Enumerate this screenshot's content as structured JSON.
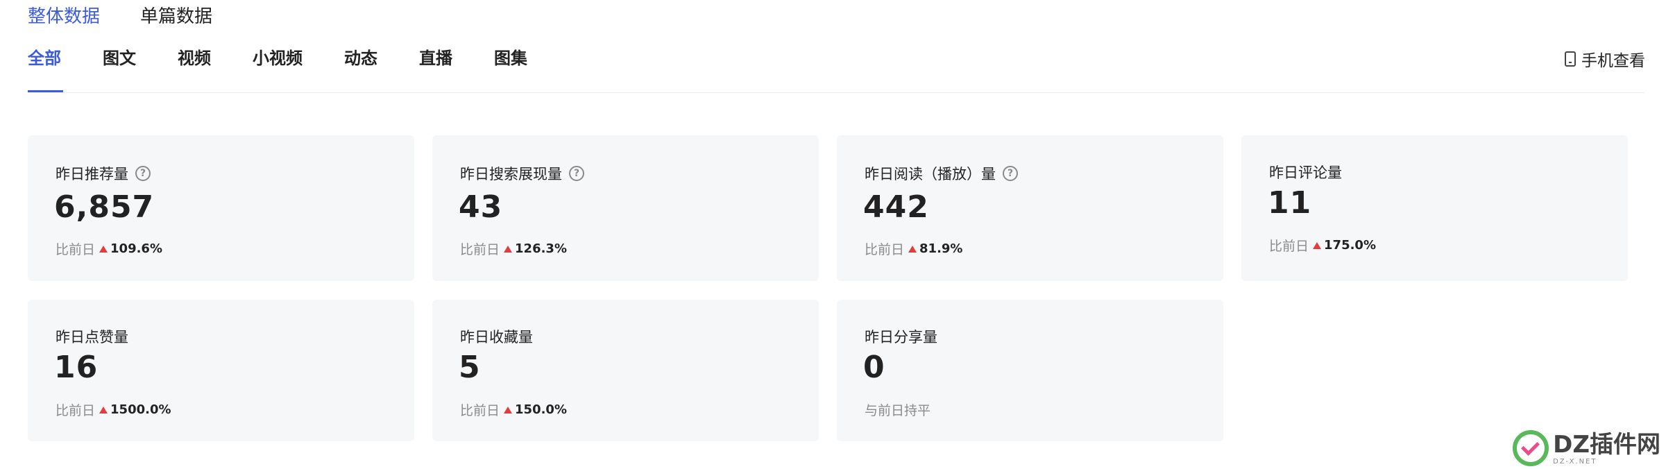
{
  "top_tabs": [
    "整体数据",
    "单篇数据"
  ],
  "sub_tabs": [
    "全部",
    "图文",
    "视频",
    "小视频",
    "动态",
    "直播",
    "图集"
  ],
  "mobile_view_label": "手机查看",
  "help_glyph": "?",
  "cards": [
    {
      "label": "昨日推荐量",
      "value": "6,857",
      "compare_prefix": "比前日",
      "change": "109.6%",
      "has_help": true
    },
    {
      "label": "昨日搜索展现量",
      "value": "43",
      "compare_prefix": "比前日",
      "change": "126.3%",
      "has_help": true
    },
    {
      "label": "昨日阅读（播放）量",
      "value": "442",
      "compare_prefix": "比前日",
      "change": "81.9%",
      "has_help": true
    },
    {
      "label": "昨日评论量",
      "value": "11",
      "compare_prefix": "比前日",
      "change": "175.0%",
      "has_help": false
    },
    {
      "label": "昨日点赞量",
      "value": "16",
      "compare_prefix": "比前日",
      "change": "1500.0%",
      "has_help": false
    },
    {
      "label": "昨日收藏量",
      "value": "5",
      "compare_prefix": "比前日",
      "change": "150.0%",
      "has_help": false
    },
    {
      "label": "昨日分享量",
      "value": "0",
      "compare_prefix": "与前日持平",
      "change": "",
      "has_help": false
    }
  ],
  "watermark": {
    "text": "DZ插件网",
    "sub": "DZ-X.NET"
  },
  "colors": {
    "accent": "#3b5bdb",
    "up": "#e23c3c",
    "card_bg": "#f6f7f9"
  }
}
